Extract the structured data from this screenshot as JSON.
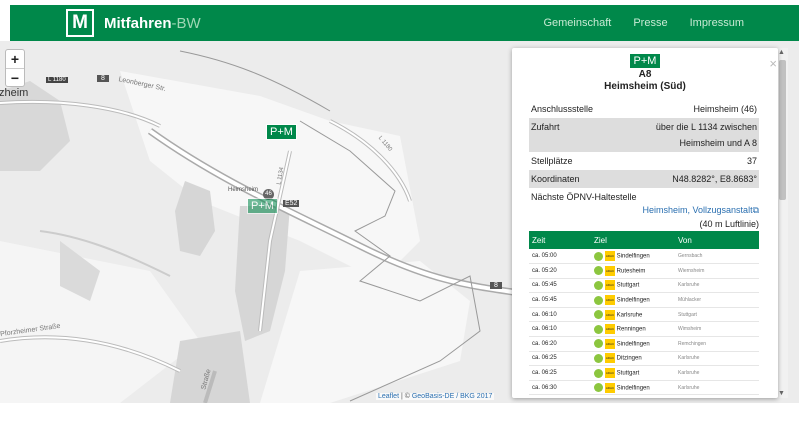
{
  "header": {
    "logo_letter": "M",
    "brand_main": "Mitfahren",
    "brand_suffix": "-BW",
    "nav": [
      "Gemeinschaft",
      "Presse",
      "Impressum"
    ]
  },
  "map": {
    "zoom_in": "+",
    "zoom_out": "−",
    "labels": {
      "town_left": "zheim",
      "road_l1180": "L 1180",
      "leonberger": "Leonberger Str.",
      "l1180_b": "L 1180",
      "l1134": "L 1134",
      "heimsheim_small": "Heimsheim",
      "exit_46": "46",
      "e52": "E52",
      "a8_right": "8",
      "a8_left": "8",
      "pforzheimer": "Pforzheimer Straße",
      "strasse": "Straße"
    },
    "pm_marker": "P+M",
    "attribution_leaflet": "Leaflet",
    "attribution_sep": " | © ",
    "attribution_geo": "GeoBasis-DE / BKG 2017"
  },
  "popup": {
    "badge": "P+M",
    "road": "A8",
    "name": "Heimsheim (Süd)",
    "close": "×",
    "fields": {
      "anschluss_label": "Anschlussstelle",
      "anschluss_value": "Heimsheim (46)",
      "zufahrt_label": "Zufahrt",
      "zufahrt_value_1": "über die L 1134 zwischen",
      "zufahrt_value_2": "Heimsheim und A 8",
      "stell_label": "Stellplätze",
      "stell_value": "37",
      "koord_label": "Koordinaten",
      "koord_value": "N48.8282°, E8.8683°",
      "oepnv_label": "Nächste ÖPNV-Haltestelle",
      "oepnv_link": "Heimsheim, Vollzugsanstalt⧉",
      "oepnv_dist": "(40 m Luftlinie)"
    },
    "table": {
      "headers": [
        "Zeit",
        "Ziel",
        "Von"
      ],
      "rows": [
        {
          "zeit": "ca. 05:00",
          "ziel": "Sindelfingen",
          "von": "Gernsbach"
        },
        {
          "zeit": "ca. 05:20",
          "ziel": "Rutesheim",
          "von": "Wiernsheim"
        },
        {
          "zeit": "ca. 05:45",
          "ziel": "Stuttgart",
          "von": "Karlsruhe"
        },
        {
          "zeit": "ca. 05:45",
          "ziel": "Sindelfingen",
          "von": "Mühlacker"
        },
        {
          "zeit": "ca. 06:10",
          "ziel": "Karlsruhe",
          "von": "Stuttgart"
        },
        {
          "zeit": "ca. 06:10",
          "ziel": "Renningen",
          "von": "Wimsheim"
        },
        {
          "zeit": "ca. 06:20",
          "ziel": "Sindelfingen",
          "von": "Remchingen"
        },
        {
          "zeit": "ca. 06:25",
          "ziel": "Ditzingen",
          "von": "Karlsruhe"
        },
        {
          "zeit": "ca. 06:25",
          "ziel": "Stuttgart",
          "von": "Karlsruhe"
        },
        {
          "zeit": "ca. 06:30",
          "ziel": "Sindelfingen",
          "von": "Karlsruhe"
        }
      ]
    },
    "icon_adac": "ADAC"
  },
  "colors": {
    "brand": "#00884a",
    "link": "#2a6fb0"
  }
}
